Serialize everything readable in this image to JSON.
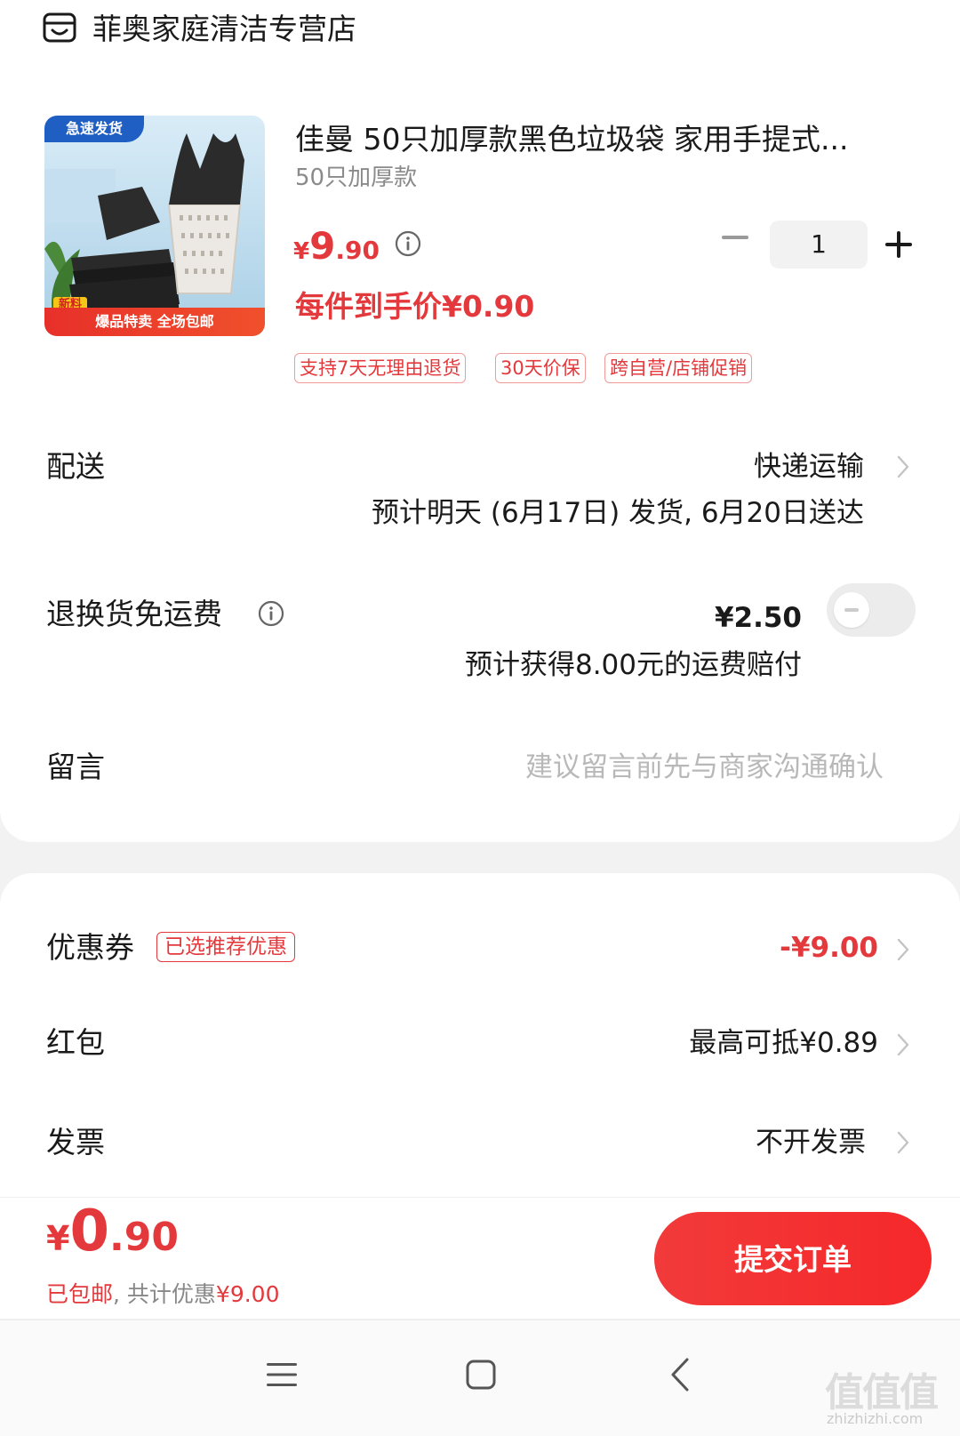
{
  "store": {
    "name": "菲奥家庭清洁专营店",
    "icon": "store-icon"
  },
  "product": {
    "title": "佳曼 50只加厚款黑色垃圾袋 家用手提式...",
    "spec": "50只加厚款",
    "image_badge": "急速发货",
    "image_new": "新料",
    "image_banner": "爆品特卖 全场包邮",
    "price_symbol": "¥",
    "price_int": "9",
    "price_dec": ".90",
    "quantity": "1",
    "per_item_price": "每件到手价¥0.90",
    "tags": [
      "支持7天无理由退货",
      "30天价保",
      "跨自营/店铺促销"
    ]
  },
  "delivery": {
    "label": "配送",
    "method": "快递运输",
    "estimate": "预计明天 (6月17日) 发货, 6月20日送达"
  },
  "return_shipping": {
    "label": "退换货免运费",
    "price": "¥2.50",
    "note": "预计获得8.00元的运费赔付",
    "enabled": false
  },
  "message": {
    "label": "留言",
    "placeholder": "建议留言前先与商家沟通确认"
  },
  "coupon": {
    "label": "优惠券",
    "tag": "已选推荐优惠",
    "value": "-¥9.00"
  },
  "red_packet": {
    "label": "红包",
    "value": "最高可抵¥0.89"
  },
  "invoice": {
    "label": "发票",
    "value": "不开发票"
  },
  "footer": {
    "total_symbol": "¥",
    "total_int": "0",
    "total_dec": ".90",
    "shipping_note": "已包邮",
    "discount_note": ", 共计优惠",
    "discount_value": "¥9.00",
    "submit_label": "提交订单"
  },
  "watermark": {
    "main": "值值值",
    "sub": "zhizhizhi.com"
  },
  "colors": {
    "accent": "#e4393c",
    "button": "#f23a3a"
  }
}
